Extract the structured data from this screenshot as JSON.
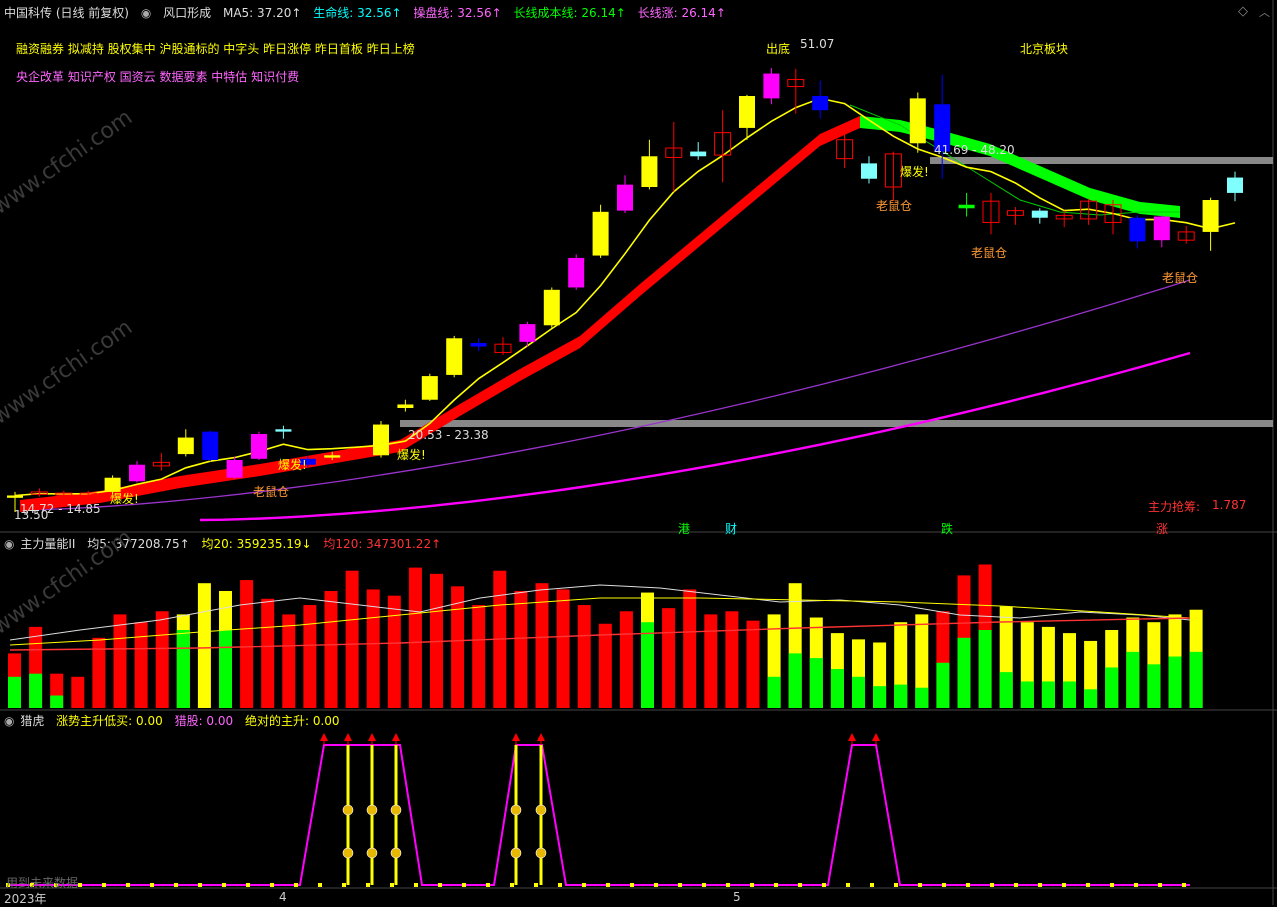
{
  "colors": {
    "up_yellow": "#ffff00",
    "up_magenta": "#ff00ff",
    "down_blue": "#0000ff",
    "down_cyan": "#80ffff",
    "red": "#ff0000",
    "green": "#00ff00",
    "yellow_line": "#ffff00",
    "purple": "#9933cc",
    "magenta_line": "#ff00ff",
    "grey": "#888888",
    "text_yellow": "#ffff00",
    "text_magenta": "#ff66ff",
    "text_orange": "#ff9933",
    "text_green": "#00ff00",
    "text_red": "#ff3333",
    "text_cyan": "#00ffff",
    "text_white": "#dddddd"
  },
  "header": {
    "stock_label": "中国科传 (日线 前复权)",
    "pattern_name": "风口形成",
    "ma5": "MA5: 37.20↑",
    "life_line": "生命线: 32.56↑",
    "operate_line": "操盘线: 32.56↑",
    "long_cost": "长线成本线: 26.14↑",
    "long_rise": "长线涨: 26.14↑"
  },
  "concepts": {
    "line1": "融资融券 拟减持 股权集中 沪股通标的 中字头 昨日涨停 昨日首板 昨日上榜",
    "line2": "央企改革 知识产权 国资云 数据要素 中特估 知识付费",
    "sector": "北京板块"
  },
  "annotations": {
    "ship_bottom": "出底",
    "high_price": "51.07",
    "burst_label": "爆发!",
    "rat_label": "老鼠仓",
    "range1": "41.69 - 48.20",
    "range2": "20.53 - 23.38",
    "range3": "14.72 - 14.85",
    "low_price": "13.50",
    "main_chip": "主力抢筹:",
    "main_chip_value": "1.787",
    "event_hk": "港",
    "event_fin": "财",
    "event_drop": "跌",
    "event_rise": "涨"
  },
  "panel2": {
    "name": "主力量能II",
    "avg5": "均5: 377208.75↑",
    "avg20": "均20: 359235.19↓",
    "avg120": "均120: 347301.22↑"
  },
  "panel3": {
    "name": "猎虎",
    "trend": "涨势主升低买: 0.00",
    "hunt": "猎股: 0.00",
    "absolute": "绝对的主升: 0.00",
    "future_note": "用到未来数据"
  },
  "xaxis": {
    "year_label": "2023年",
    "april": "4",
    "may": "5"
  },
  "watermark": "www.cfchi.com",
  "chart_data": {
    "type": "candlestick",
    "title": "中国科传 (日线 前复权)",
    "price_range": [
      13.5,
      51.07
    ],
    "candles": [
      [
        14.7,
        14.9,
        13.5,
        15.2,
        "y"
      ],
      [
        15.0,
        15.2,
        14.8,
        15.5,
        "r"
      ],
      [
        15.1,
        15.0,
        14.7,
        15.3,
        "r"
      ],
      [
        15.0,
        15.1,
        14.8,
        15.3,
        "r"
      ],
      [
        15.2,
        16.4,
        15.0,
        16.6,
        "y"
      ],
      [
        16.1,
        17.5,
        16.0,
        17.8,
        "m"
      ],
      [
        17.7,
        17.4,
        17.0,
        18.5,
        "r"
      ],
      [
        18.4,
        19.8,
        18.2,
        20.5,
        "y"
      ],
      [
        20.3,
        17.9,
        17.8,
        20.4,
        "b"
      ],
      [
        16.4,
        17.9,
        16.3,
        18.2,
        "m"
      ],
      [
        18.0,
        20.1,
        17.9,
        20.3,
        "m"
      ],
      [
        20.3,
        20.5,
        19.7,
        20.8,
        "c"
      ],
      [
        18.0,
        17.5,
        17.3,
        18.2,
        "b"
      ],
      [
        18.1,
        18.3,
        17.9,
        18.6,
        "y"
      ],
      [
        18.2,
        18.5,
        18.0,
        18.8,
        "r"
      ],
      [
        18.3,
        20.9,
        18.1,
        21.2,
        "y"
      ],
      [
        22.6,
        22.3,
        22.0,
        23.0,
        "y"
      ],
      [
        23.0,
        25.0,
        22.9,
        25.2,
        "y"
      ],
      [
        25.1,
        28.2,
        24.9,
        28.4,
        "y"
      ],
      [
        27.8,
        27.5,
        27.1,
        28.2,
        "b"
      ],
      [
        27.0,
        27.7,
        26.8,
        28.3,
        "r"
      ],
      [
        27.9,
        29.4,
        27.5,
        29.6,
        "m"
      ],
      [
        29.3,
        32.3,
        29.1,
        32.5,
        "y"
      ],
      [
        32.5,
        35.0,
        32.3,
        35.3,
        "m"
      ],
      [
        35.2,
        38.9,
        35.0,
        39.5,
        "y"
      ],
      [
        39.0,
        41.2,
        38.8,
        42.0,
        "m"
      ],
      [
        41.0,
        43.6,
        40.8,
        45.0,
        "y"
      ],
      [
        43.5,
        44.3,
        40.6,
        46.5,
        "r"
      ],
      [
        44.0,
        43.6,
        43.3,
        44.8,
        "c"
      ],
      [
        43.7,
        45.6,
        41.4,
        47.5,
        "r"
      ],
      [
        46.0,
        48.7,
        45.0,
        48.8,
        "y"
      ],
      [
        48.5,
        50.6,
        48.0,
        51.07,
        "m"
      ],
      [
        49.5,
        50.1,
        47.2,
        51.0,
        "r"
      ],
      [
        48.7,
        47.5,
        46.8,
        50.0,
        "b"
      ],
      [
        45.0,
        43.4,
        42.6,
        46.3,
        "r"
      ],
      [
        43.0,
        41.7,
        41.3,
        43.6,
        "c"
      ],
      [
        41.0,
        43.8,
        39.8,
        44.0,
        "r"
      ],
      [
        48.5,
        44.7,
        43.9,
        49.0,
        "y"
      ],
      [
        48.0,
        44.0,
        41.7,
        50.5,
        "b"
      ],
      [
        39.5,
        39.2,
        38.5,
        40.5,
        "g"
      ],
      [
        38.0,
        39.8,
        37.0,
        40.5,
        "r"
      ],
      [
        38.6,
        39.0,
        37.8,
        39.3,
        "r"
      ],
      [
        39.0,
        38.4,
        37.9,
        39.2,
        "c"
      ],
      [
        38.3,
        38.6,
        37.6,
        39.0,
        "r"
      ],
      [
        38.3,
        39.8,
        37.8,
        40.0,
        "r"
      ],
      [
        39.5,
        38.0,
        37.0,
        39.9,
        "r"
      ],
      [
        38.4,
        36.4,
        35.8,
        38.6,
        "b"
      ],
      [
        36.5,
        38.5,
        35.9,
        38.6,
        "m"
      ],
      [
        36.5,
        37.2,
        36.2,
        37.7,
        "r"
      ],
      [
        39.9,
        37.2,
        35.6,
        40.1,
        "y"
      ],
      [
        41.8,
        40.5,
        39.8,
        42.3,
        "c"
      ]
    ],
    "volume_bars": [
      [
        35,
        20
      ],
      [
        52,
        22
      ],
      [
        22,
        8
      ],
      [
        20,
        0
      ],
      [
        45,
        0
      ],
      [
        60,
        0
      ],
      [
        55,
        0
      ],
      [
        62,
        0
      ],
      [
        60,
        50
      ],
      [
        80,
        0
      ],
      [
        75,
        50
      ],
      [
        82,
        0
      ],
      [
        70,
        0
      ],
      [
        60,
        0
      ],
      [
        66,
        0
      ],
      [
        75,
        0
      ],
      [
        88,
        0
      ],
      [
        76,
        0
      ],
      [
        72,
        0
      ],
      [
        90,
        0
      ],
      [
        86,
        0
      ],
      [
        78,
        0
      ],
      [
        66,
        0
      ],
      [
        88,
        0
      ],
      [
        75,
        0
      ],
      [
        80,
        0
      ],
      [
        76,
        0
      ],
      [
        66,
        0
      ],
      [
        54,
        0
      ],
      [
        62,
        0
      ],
      [
        74,
        55
      ],
      [
        64,
        0
      ],
      [
        76,
        0
      ],
      [
        60,
        0
      ],
      [
        62,
        0
      ],
      [
        56,
        0
      ],
      [
        60,
        20
      ],
      [
        80,
        35
      ],
      [
        58,
        32
      ],
      [
        48,
        25
      ],
      [
        44,
        20
      ],
      [
        42,
        14
      ],
      [
        55,
        15
      ],
      [
        60,
        13
      ],
      [
        62,
        29
      ],
      [
        85,
        45
      ],
      [
        92,
        50
      ],
      [
        65,
        23
      ],
      [
        55,
        17
      ],
      [
        52,
        17
      ],
      [
        48,
        17
      ],
      [
        43,
        12
      ],
      [
        50,
        26
      ],
      [
        58,
        36
      ],
      [
        55,
        28
      ],
      [
        60,
        33
      ],
      [
        63,
        36
      ]
    ]
  }
}
